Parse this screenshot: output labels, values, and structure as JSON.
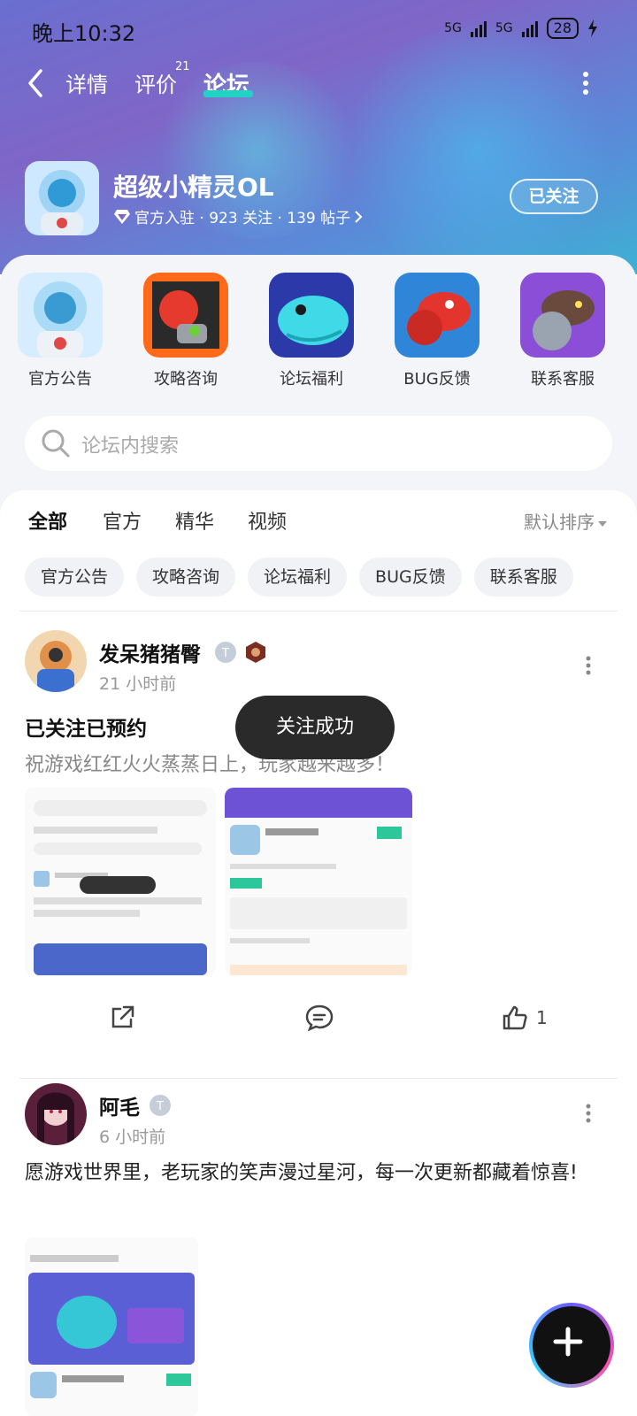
{
  "status": {
    "time": "晚上10:32",
    "net1": "5G",
    "net2": "5G",
    "battery": "28"
  },
  "nav": {
    "tabs": [
      "详情",
      "评价",
      "论坛"
    ],
    "review_count": "21",
    "active": "论坛"
  },
  "game": {
    "name": "超级小精灵OL",
    "meta": "官方入驻 · 923 关注 · 139 帖子",
    "follow_label": "已关注"
  },
  "categories": [
    {
      "label": "官方公告",
      "icon": "official-notice-icon"
    },
    {
      "label": "攻略咨询",
      "icon": "strategy-icon"
    },
    {
      "label": "论坛福利",
      "icon": "welfare-icon"
    },
    {
      "label": "BUG反馈",
      "icon": "bug-icon"
    },
    {
      "label": "联系客服",
      "icon": "support-icon"
    }
  ],
  "search": {
    "placeholder": "论坛内搜索"
  },
  "filter_tabs": [
    "全部",
    "官方",
    "精华",
    "视频"
  ],
  "sort_label": "默认排序",
  "chips": [
    "官方公告",
    "攻略咨询",
    "论坛福利",
    "BUG反馈",
    "联系客服"
  ],
  "posts": [
    {
      "author": "发呆猪猪臀",
      "time": "21 小时前",
      "title": "已关注已预约",
      "body": "祝游戏红红火火蒸蒸日上，玩家越来越多！",
      "likes": "1"
    },
    {
      "author": "阿毛",
      "time": "6 小时前",
      "body": "愿游戏世界里，老玩家的笑声漫过星河，每一次更新都藏着惊喜!"
    }
  ],
  "toast": "关注成功",
  "colors": {
    "accent": "#22d3c5",
    "hero_start": "#6a6fd0",
    "hero_end": "#3db1d4"
  }
}
